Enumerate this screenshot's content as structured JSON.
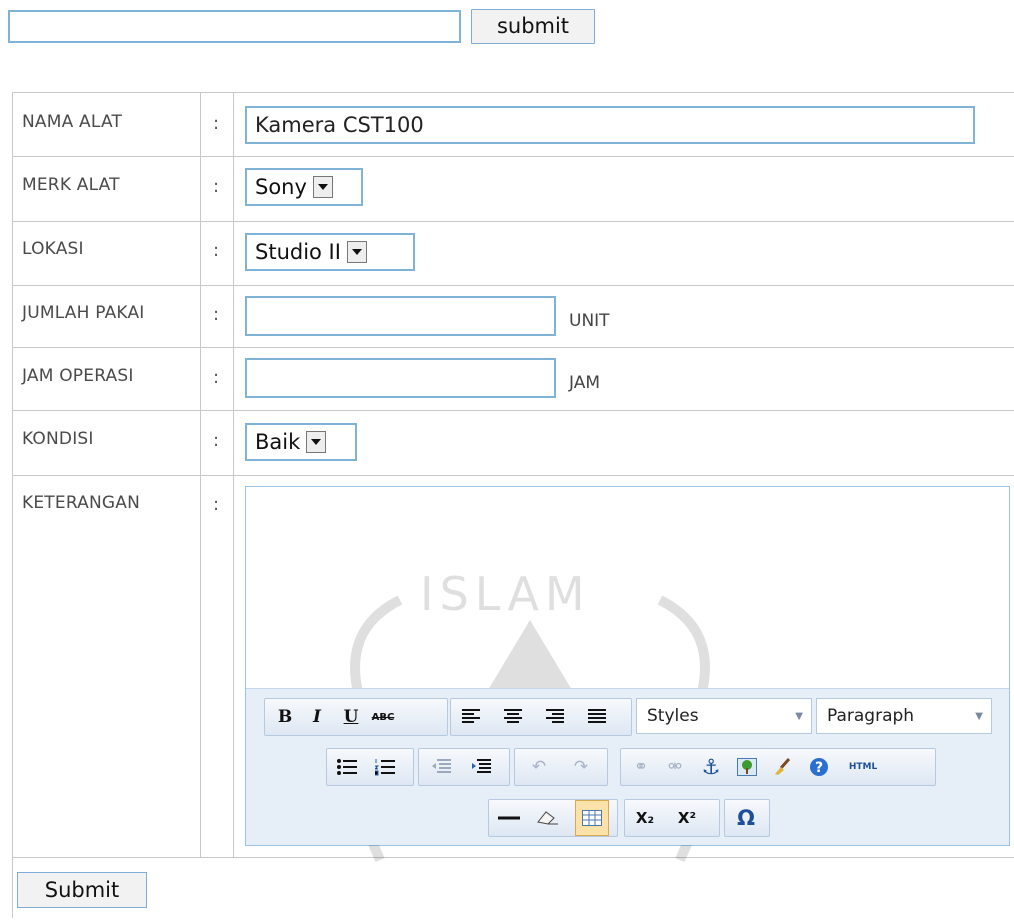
{
  "top": {
    "search_value": "",
    "submit_label": "submit"
  },
  "form": {
    "rows": [
      {
        "label": "NAMA ALAT",
        "colon": ":"
      },
      {
        "label": "MERK ALAT",
        "colon": ":"
      },
      {
        "label": "LOKASI",
        "colon": ":"
      },
      {
        "label": "JUMLAH PAKAI",
        "colon": ":"
      },
      {
        "label": "JAM OPERASI",
        "colon": ":"
      },
      {
        "label": "KONDISI",
        "colon": ":"
      },
      {
        "label": "KETERANGAN",
        "colon": ":"
      }
    ],
    "nama_alat_value": "Kamera CST100",
    "merk_alat_selected": "Sony",
    "lokasi_selected": "Studio II",
    "jumlah_pakai_value": "",
    "jumlah_pakai_unit": "UNIT",
    "jam_operasi_value": "",
    "jam_operasi_unit": "JAM",
    "kondisi_selected": "Baik",
    "submit_label": "Submit"
  },
  "editor": {
    "content": "",
    "styles_label": "Styles",
    "format_label": "Paragraph",
    "buttons": {
      "bold": "B",
      "italic": "I",
      "underline": "U",
      "strikethrough": "ABC",
      "html": "HTML",
      "subscript": "X₂",
      "superscript": "X²",
      "omega": "Ω"
    }
  },
  "watermark": {
    "text": "ISLAM"
  },
  "colors": {
    "field_border": "#7fb3d8",
    "toolbar_bg": "#e6eef8",
    "grid_line": "#c8c8c8"
  }
}
